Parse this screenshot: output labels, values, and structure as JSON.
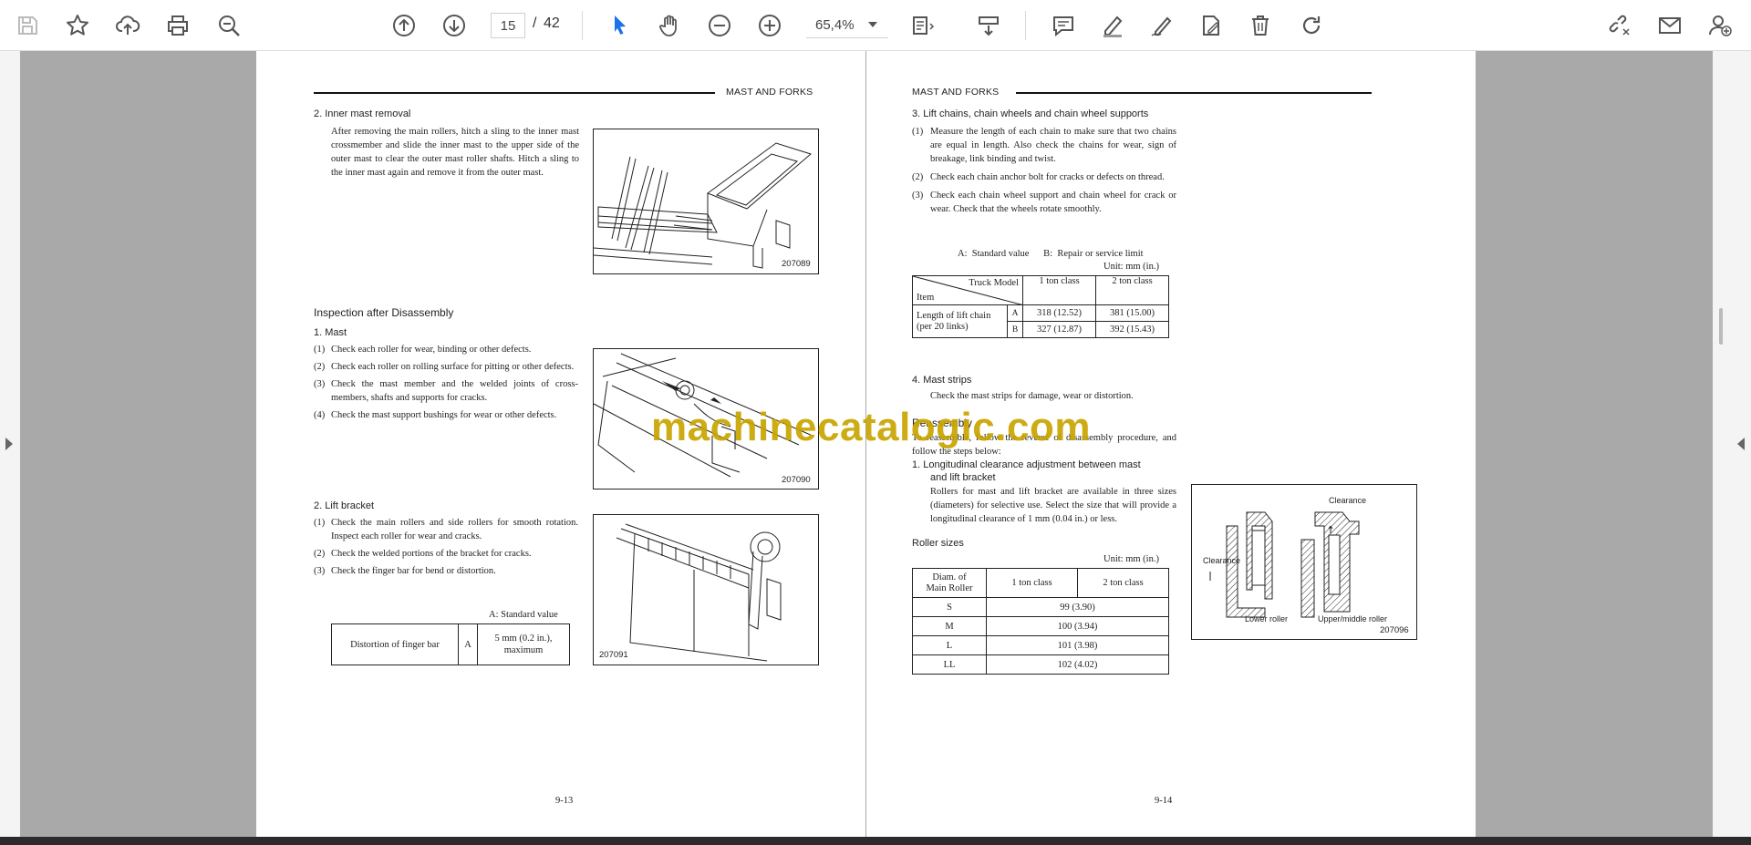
{
  "toolbar": {
    "page_current": "15",
    "page_separator": "/",
    "page_total": "42",
    "zoom": "65,4%",
    "accent_color": "#1a73e8"
  },
  "left_page": {
    "header": "MAST AND FORKS",
    "s1_title": "2.   Inner mast removal",
    "s1_body": "After removing the main rollers, hitch a sling to the inner mast crossmember and slide the inner mast to the upper side of the outer mast to clear the outer mast roller shafts.  Hitch a sling to the inner mast again and remove it from the outer mast.",
    "fig1": "207089",
    "inspection_title": "Inspection after Disassembly",
    "s2_title": "1.   Mast",
    "mast_items": [
      {
        "n": "(1)",
        "text": "Check each roller for wear, binding or other defects."
      },
      {
        "n": "(2)",
        "text": "Check each roller on rolling surface for pitting or other defects."
      },
      {
        "n": "(3)",
        "text": "Check the mast member and the welded joints of cross-members, shafts and supports for cracks."
      },
      {
        "n": "(4)",
        "text": "Check the mast support bushings for wear or other defects."
      }
    ],
    "fig2": "207090",
    "s3_title": "2.   Lift bracket",
    "bracket_items": [
      {
        "n": "(1)",
        "text": "Check the main rollers and side rollers for smooth rotation.  Inspect each roller for wear and cracks."
      },
      {
        "n": "(2)",
        "text": "Check the welded portions of the bracket for cracks."
      },
      {
        "n": "(3)",
        "text": "Check the finger bar for bend or distortion."
      }
    ],
    "std_label": "A:  Standard value",
    "table": {
      "item": "Distortion of finger bar",
      "code": "A",
      "value_line1": "5 mm (0.2 in.),",
      "value_line2": "maximum"
    },
    "fig3": "207091",
    "page_number": "9-13"
  },
  "right_page": {
    "header": "MAST AND FORKS",
    "s1_title": "3.   Lift chains, chain wheels and chain wheel supports",
    "items": [
      {
        "n": "(1)",
        "text": "Measure the length of each chain to make sure that two chains are equal in length.  Also check the chains for wear, sign of breakage, link binding and twist."
      },
      {
        "n": "(2)",
        "text": "Check each chain anchor bolt for cracks or defects on thread."
      },
      {
        "n": "(3)",
        "text": "Check each chain wheel support and chain wheel for crack or wear.  Check that the wheels rotate smoothly."
      }
    ],
    "legend": "A:  Standard value      B:  Repair or service limit",
    "unit": "Unit:  mm (in.)",
    "chain_table": {
      "corner_top": "Truck Model",
      "corner_bottom": "Item",
      "col1": "1 ton class",
      "col2": "2 ton class",
      "row_label_line1": "Length of lift chain",
      "row_label_line2": "(per 20 links)",
      "rows": [
        {
          "code": "A",
          "v1": "318 (12.52)",
          "v2": "381 (15.00)"
        },
        {
          "code": "B",
          "v1": "327 (12.87)",
          "v2": "392 (15.43)"
        }
      ]
    },
    "s2_title": "4.   Mast strips",
    "s2_body": "Check the mast strips for damage, wear or distortion.",
    "reassembly_title": "Reassembly",
    "reassembly_body": "To reassemble, follow the reverse of disassembly procedure, and follow the steps below:",
    "s3_title_line1": "1.   Longitudinal clearance adjustment between mast",
    "s3_title_line2": "and lift bracket",
    "s3_body": "Rollers for mast and lift bracket are available in three sizes (diameters) for selective use.  Select the size that will provide a longitudinal clearance of 1 mm (0.04 in.) or less.",
    "roller_title": "Roller sizes",
    "roller_unit": "Unit:  mm (in.)",
    "roller_table": {
      "h1_line1": "Diam. of",
      "h1_line2": "Main Roller",
      "h2": "1 ton class",
      "h3": "2 ton class",
      "rows": [
        {
          "size": "S",
          "value": "99 (3.90)"
        },
        {
          "size": "M",
          "value": "100 (3.94)"
        },
        {
          "size": "L",
          "value": "101 (3.98)"
        },
        {
          "size": "LL",
          "value": "102 (4.02)"
        }
      ]
    },
    "fig": {
      "clearance_top": "Clearance",
      "clearance_left": "Clearance",
      "lower_roller": "Lower roller",
      "upper_roller": "Upper/middle roller",
      "number": "207096"
    },
    "page_number": "9-14"
  },
  "watermark": "machinecatalogic.com"
}
